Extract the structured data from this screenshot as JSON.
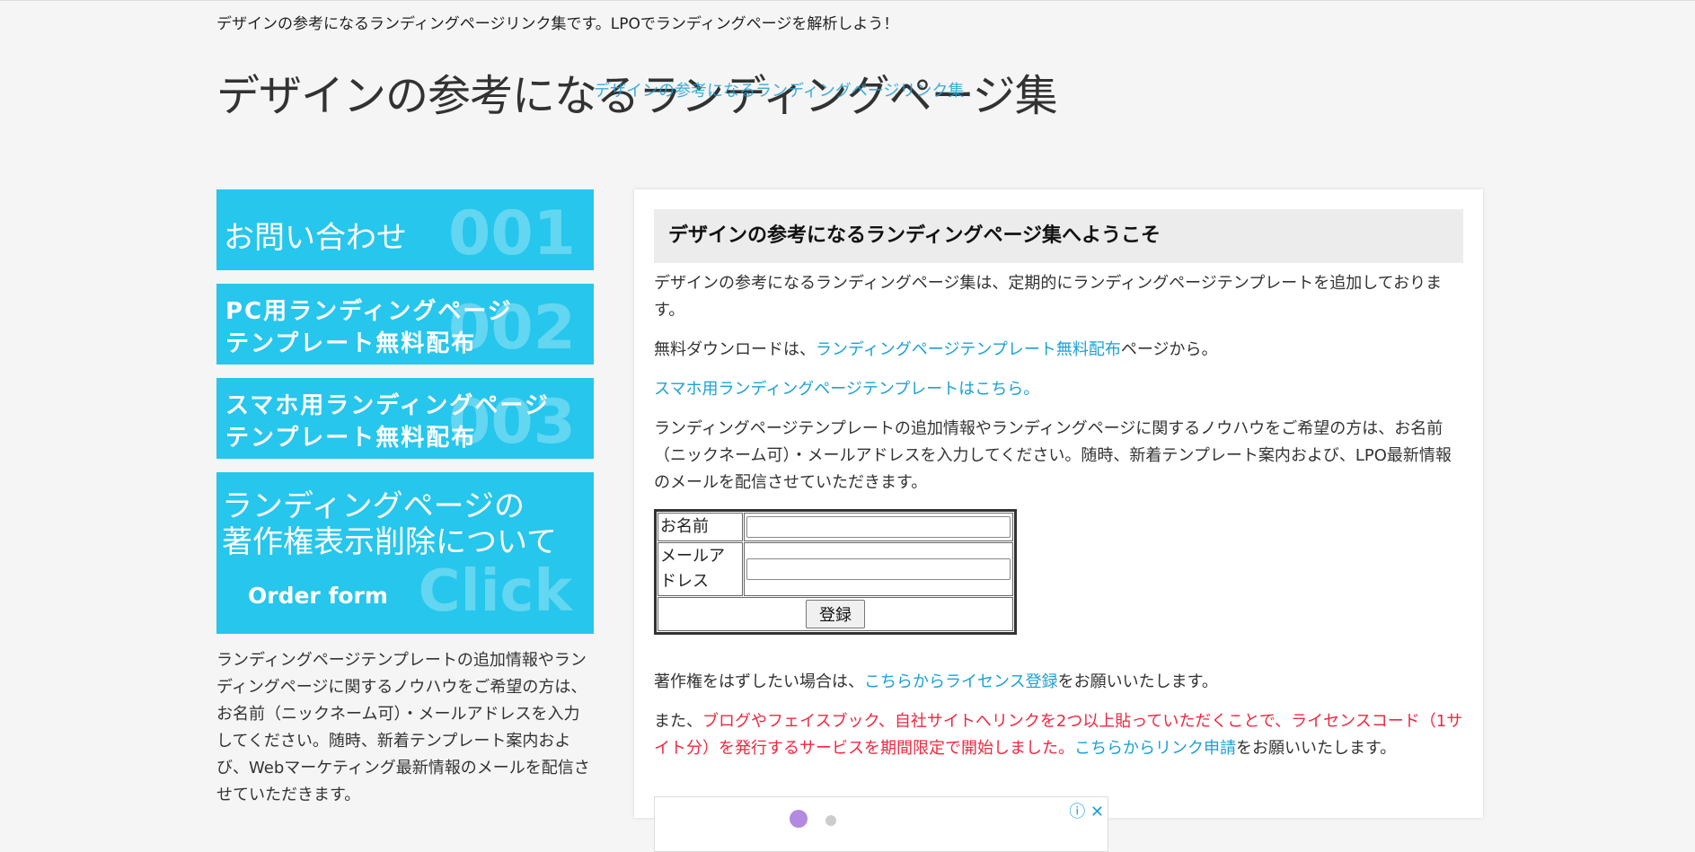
{
  "header": {
    "tagline": "デザインの参考になるランディングページリンク集です。LPOでランディングページを解析しよう！",
    "logo_text": "デザインの参考になるランディングページ集",
    "logo_link": "デザインの参考になるランディングページリンク集"
  },
  "sidebar": {
    "banners": [
      {
        "lines": [
          "お問い合わせ"
        ],
        "num": "001"
      },
      {
        "lines": [
          "PC用ランディングページ",
          "テンプレート無料配布"
        ],
        "num": "002"
      },
      {
        "lines": [
          "スマホ用ランディングページ",
          "テンプレート無料配布"
        ],
        "num": "003"
      },
      {
        "lines": [
          "ランディングページの",
          "著作権表示削除について",
          "Order form"
        ],
        "num": "Click"
      }
    ],
    "text": "ランディングページテンプレートの追加情報やランディングページに関するノウハウをご希望の方は、お名前（ニックネーム可）・メールアドレスを入力してください。随時、新着テンプレート案内および、Webマーケティング最新情報のメールを配信させていただきます。"
  },
  "main": {
    "title": "デザインの参考になるランディングページ集へようこそ",
    "intro": "デザインの参考になるランディングページ集は、定期的にランディングページテンプレートを追加しております。",
    "download_prefix": "無料ダウンロードは、",
    "download_link": "ランディングページテンプレート無料配布",
    "download_suffix": "ページから。",
    "smartphone_link": "スマホ用ランディングページテンプレートはこちら。",
    "signup_text": "ランディングページテンプレートの追加情報やランディングページに関するノウハウをご希望の方は、お名前（ニックネーム可）・メールアドレスを入力してください。随時、新着テンプレート案内および、LPO最新情報のメールを配信させていただきます。",
    "form": {
      "name_label": "お名前",
      "email_label": "メールアドレス",
      "name_value": "",
      "email_value": "",
      "submit_label": "登録"
    },
    "copyright_prefix": "著作権をはずしたい場合は、",
    "copyright_link": "こちらからライセンス登録",
    "copyright_suffix": "をお願いいたします。",
    "promo_prefix": "また、",
    "promo_red": "ブログやフェイスブック、自社サイトへリンクを2つ以上貼っていただくことで、ライセンスコード（1サイト分）を発行するサービスを期間限定で開始しました。",
    "promo_link": "こちらからリンク申請",
    "promo_suffix": "をお願いいたします。",
    "ad_icons": "ⓘ ✕"
  },
  "colors": {
    "accent": "#27c6ec",
    "link": "#1ba1d6",
    "promo": "#f2263f"
  }
}
